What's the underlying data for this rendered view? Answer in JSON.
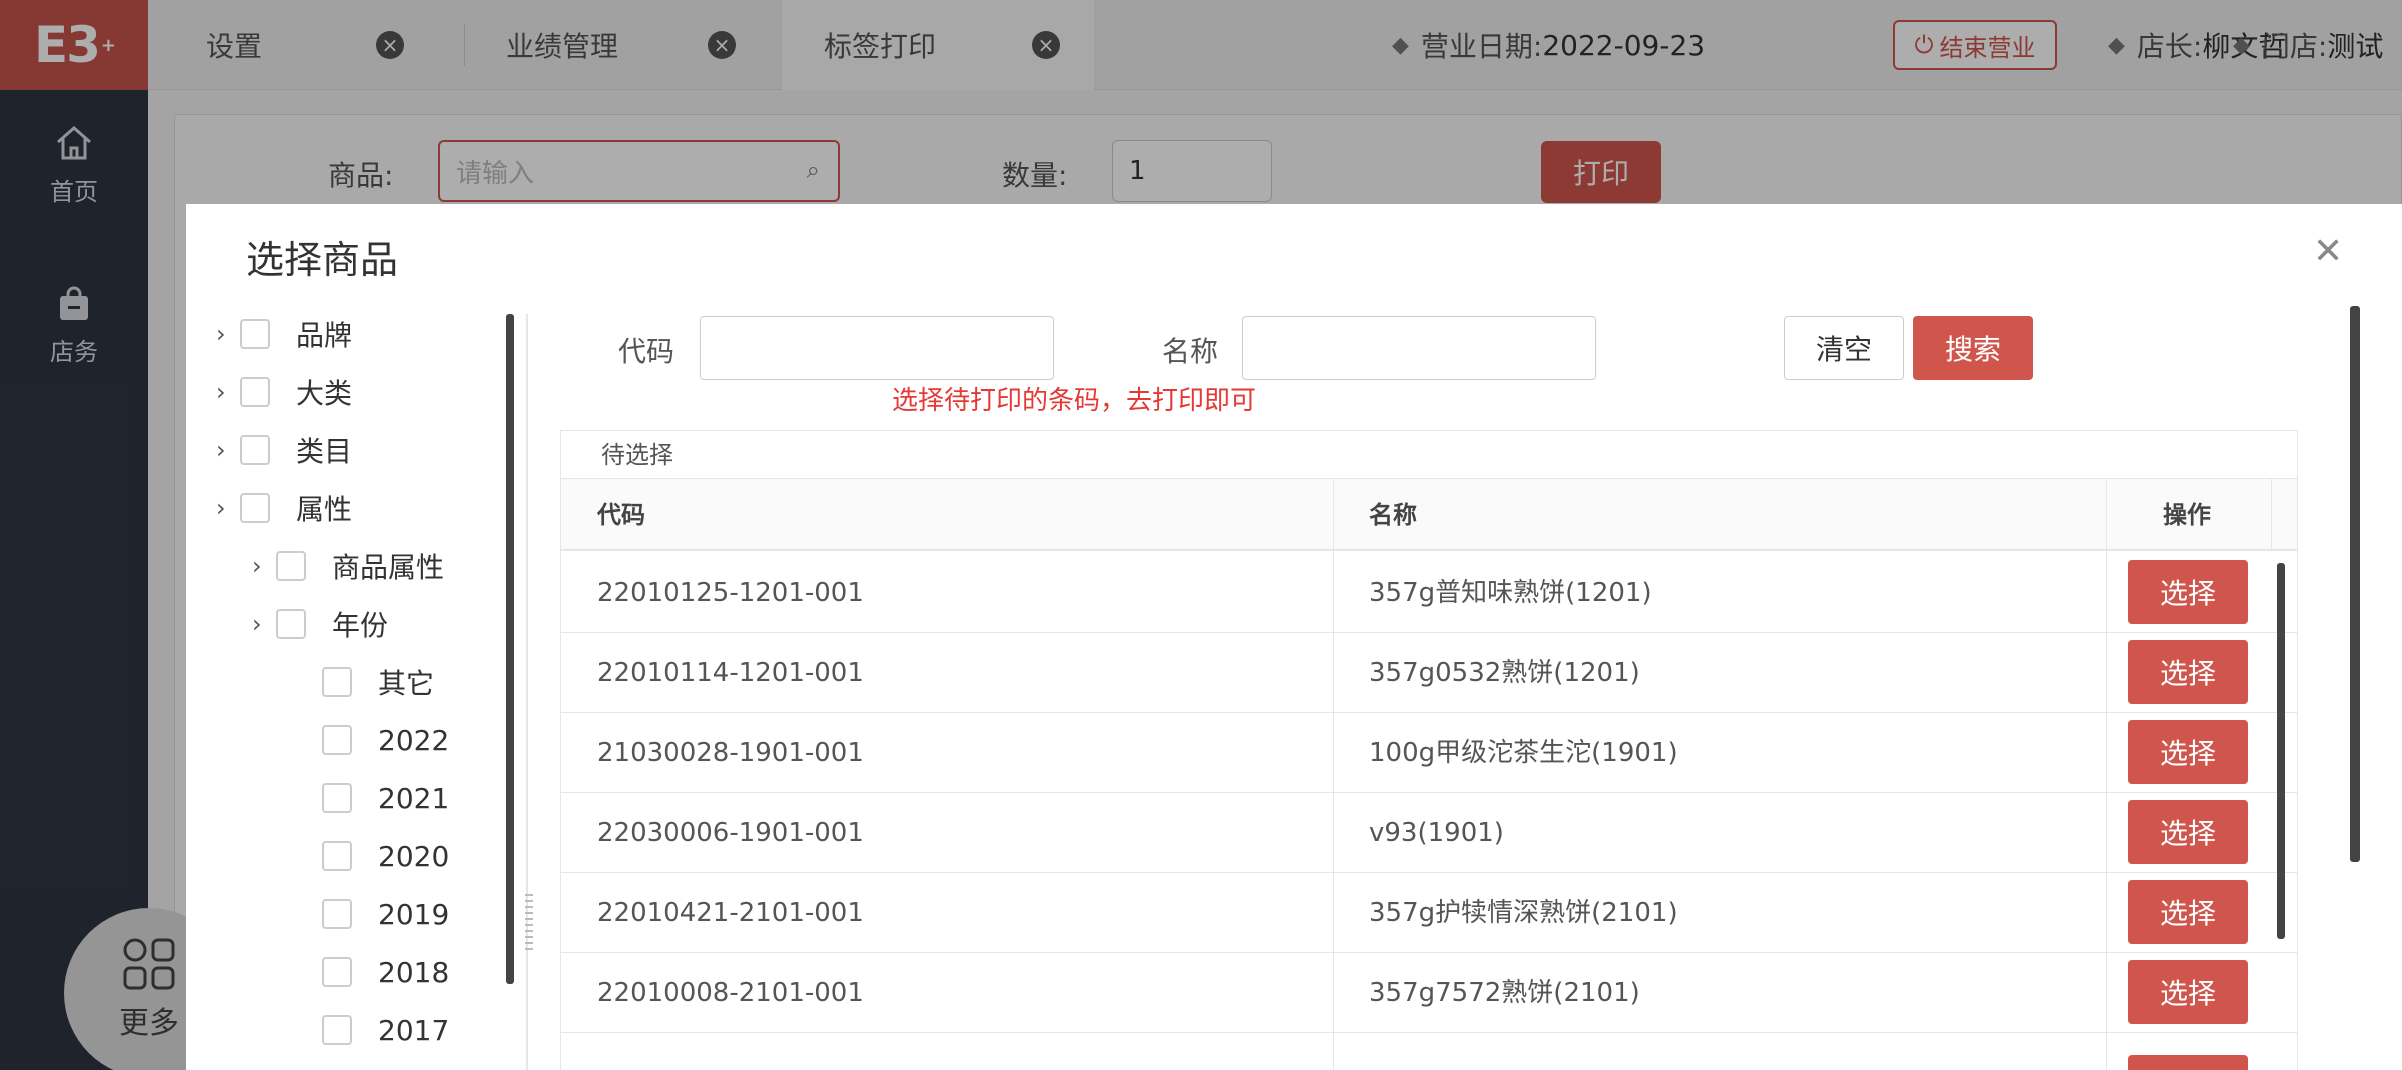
{
  "app": {
    "logo": "E3",
    "logo_sup": "+"
  },
  "sidebar": {
    "home": "首页",
    "store": "店务",
    "more": "更多"
  },
  "tabs": [
    {
      "label": "设置"
    },
    {
      "label": "业绩管理"
    },
    {
      "label": "标签打印"
    }
  ],
  "header": {
    "business_date_label": "营业日期:",
    "business_date": "2022-09-23",
    "end_business": "结束营业",
    "manager_label": "店长:",
    "manager": "柳文哲",
    "store_label": "门店:",
    "store": "测试"
  },
  "form": {
    "product_label": "商品:",
    "product_placeholder": "请输入",
    "qty_label": "数量:",
    "qty_value": "1",
    "print": "打印"
  },
  "modal": {
    "title": "选择商品",
    "tree": [
      {
        "label": "品牌"
      },
      {
        "label": "大类"
      },
      {
        "label": "类目"
      },
      {
        "label": "属性"
      },
      {
        "label": "商品属性"
      },
      {
        "label": "年份"
      },
      {
        "label": "其它"
      },
      {
        "label": "2022"
      },
      {
        "label": "2021"
      },
      {
        "label": "2020"
      },
      {
        "label": "2019"
      },
      {
        "label": "2018"
      },
      {
        "label": "2017"
      }
    ],
    "code_label": "代码",
    "name_label": "名称",
    "clear": "清空",
    "search": "搜索",
    "hint": "选择待打印的条码，去打印即可",
    "table_caption": "待选择",
    "columns": {
      "code": "代码",
      "name": "名称",
      "action": "操作"
    },
    "select_label": "选择",
    "rows": [
      {
        "code": "22010125-1201-001",
        "name": "357g普知味熟饼(1201)"
      },
      {
        "code": "22010114-1201-001",
        "name": "357g0532熟饼(1201)"
      },
      {
        "code": "21030028-1901-001",
        "name": "100g甲级沱茶生沱(1901)"
      },
      {
        "code": "22030006-1901-001",
        "name": "v93(1901)"
      },
      {
        "code": "22010421-2101-001",
        "name": "357g护犊情深熟饼(2101)"
      },
      {
        "code": "22010008-2101-001",
        "name": "357g7572熟饼(2101)"
      }
    ]
  }
}
